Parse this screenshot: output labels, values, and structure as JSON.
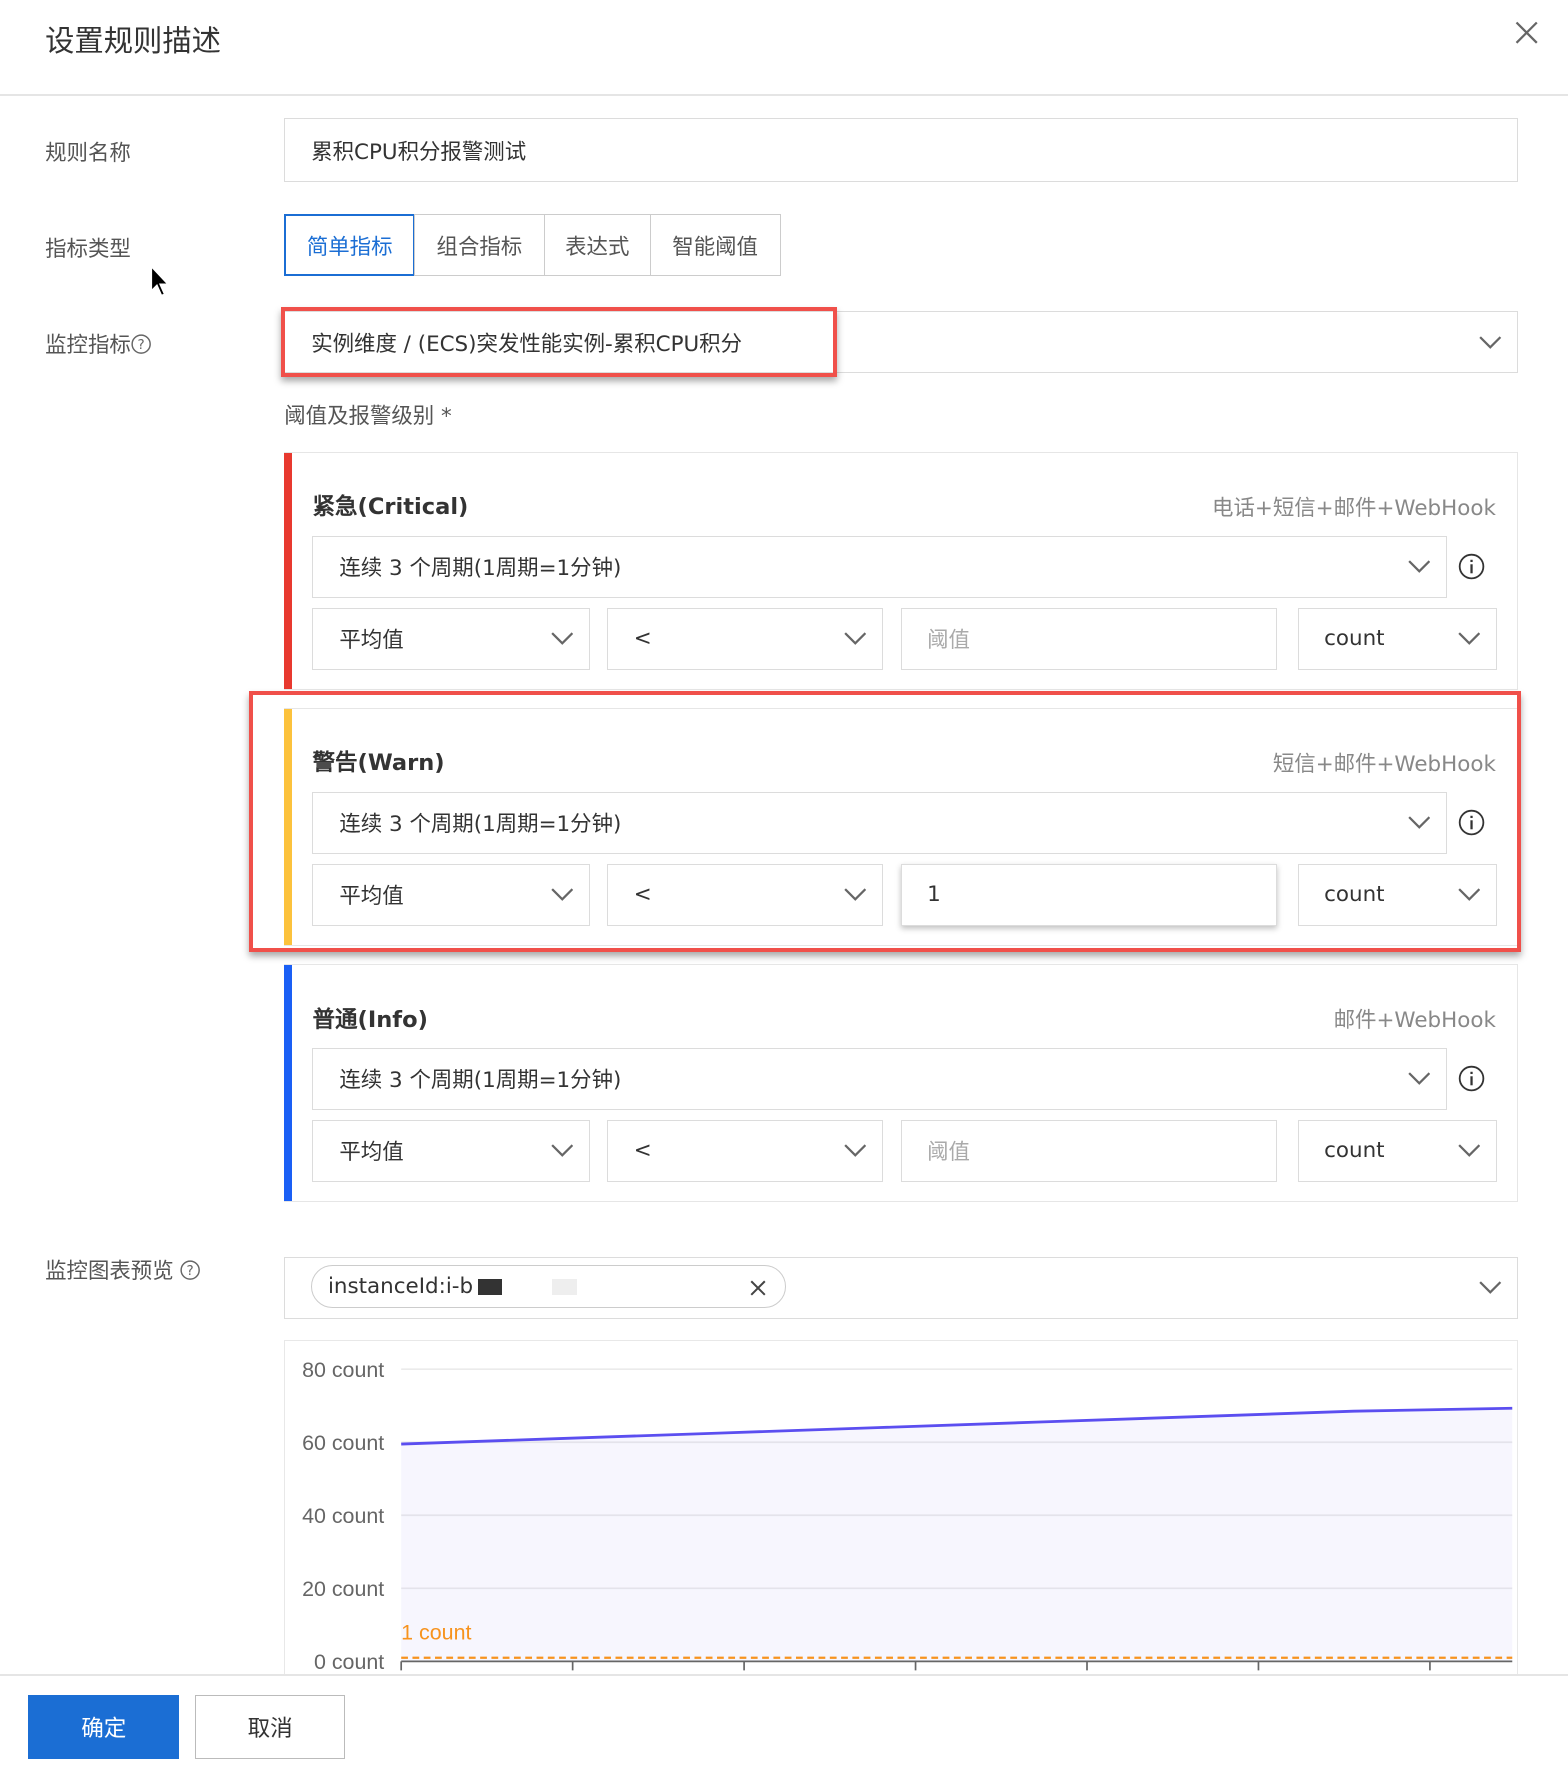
{
  "dialog": {
    "title": "设置规则描述"
  },
  "form": {
    "rule_name_label": "规则名称",
    "rule_name_value": "累积CPU积分报警测试",
    "metric_type_label": "指标类型",
    "metric_type_tabs": [
      "简单指标",
      "组合指标",
      "表达式",
      "智能阈值"
    ],
    "metric_label": "监控指标",
    "metric_value": "实例维度 / (ECS)突发性能实例-累积CPU积分",
    "threshold_label": "阈值及报警级别 *"
  },
  "levels": [
    {
      "title": "紧急(Critical)",
      "notify": "电话+短信+邮件+WebHook",
      "period": "连续 3 个周期(1周期=1分钟)",
      "stat": "平均值",
      "op": "<",
      "threshold": "",
      "threshold_placeholder": "阈值",
      "unit": "count",
      "color": "#e8392f"
    },
    {
      "title": "警告(Warn)",
      "notify": "短信+邮件+WebHook",
      "period": "连续 3 个周期(1周期=1分钟)",
      "stat": "平均值",
      "op": "<",
      "threshold": "1",
      "threshold_placeholder": "阈值",
      "unit": "count",
      "color": "#fcc23c"
    },
    {
      "title": "普通(Info)",
      "notify": "邮件+WebHook",
      "period": "连续 3 个周期(1周期=1分钟)",
      "stat": "平均值",
      "op": "<",
      "threshold": "",
      "threshold_placeholder": "阈值",
      "unit": "count",
      "color": "#1a5ff5"
    }
  ],
  "preview": {
    "label": "监控图表预览",
    "tag": "instanceId:i-b"
  },
  "chart_data": {
    "type": "area",
    "y_ticks": [
      "80 count",
      "60 count",
      "40 count",
      "20 count",
      "0 count"
    ],
    "ylim": [
      0,
      80
    ],
    "series": [
      {
        "name": "instanceId",
        "values": [
          59.5,
          61,
          62.5,
          64,
          65.5,
          67,
          68.5,
          69.3
        ],
        "color": "#5b4ef0"
      }
    ],
    "threshold": {
      "value": 1,
      "label": "1 count",
      "color": "#f7931e"
    },
    "grid": true
  },
  "footer": {
    "confirm": "确定",
    "cancel": "取消"
  }
}
